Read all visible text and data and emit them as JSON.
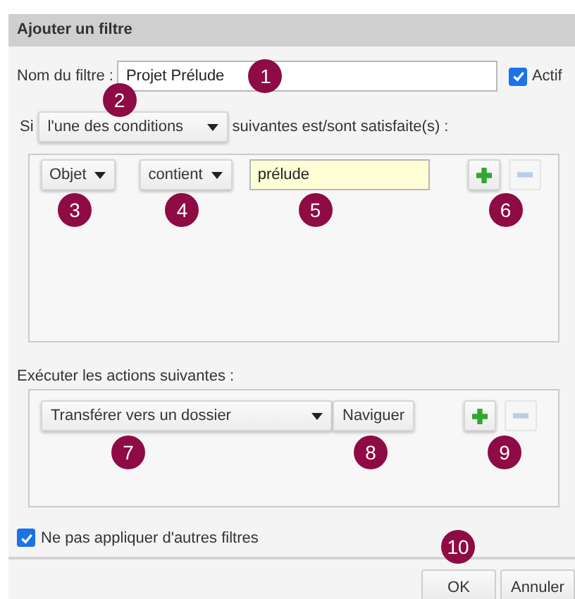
{
  "dialog": {
    "title": "Ajouter un filtre"
  },
  "name_row": {
    "label": "Nom du filtre :",
    "value": "Projet Prélude",
    "marker": "1",
    "active": {
      "label": "Actif",
      "checked": true
    }
  },
  "match_row": {
    "prefix": "Si",
    "select": {
      "value": "l'une des conditions",
      "marker": "2"
    },
    "suffix": "suivantes est/sont satisfaite(s) :"
  },
  "conditions": [
    {
      "field": {
        "value": "Objet",
        "marker": "3"
      },
      "operator": {
        "value": "contient",
        "marker": "4"
      },
      "text": {
        "value": "prélude",
        "marker": "5"
      },
      "buttons_marker": "6",
      "remove_disabled": true
    }
  ],
  "actions_label": "Exécuter les actions suivantes :",
  "actions": [
    {
      "action": {
        "value": "Transférer vers un dossier",
        "marker": "7"
      },
      "browse": {
        "label": "Naviguer",
        "marker": "8"
      },
      "buttons_marker": "9",
      "remove_disabled": true
    }
  ],
  "stop_option": {
    "label": "Ne pas appliquer d'autres filtres",
    "checked": true
  },
  "buttons": [
    {
      "label": "OK",
      "marker": "10"
    },
    {
      "label": "Annuler"
    }
  ]
}
